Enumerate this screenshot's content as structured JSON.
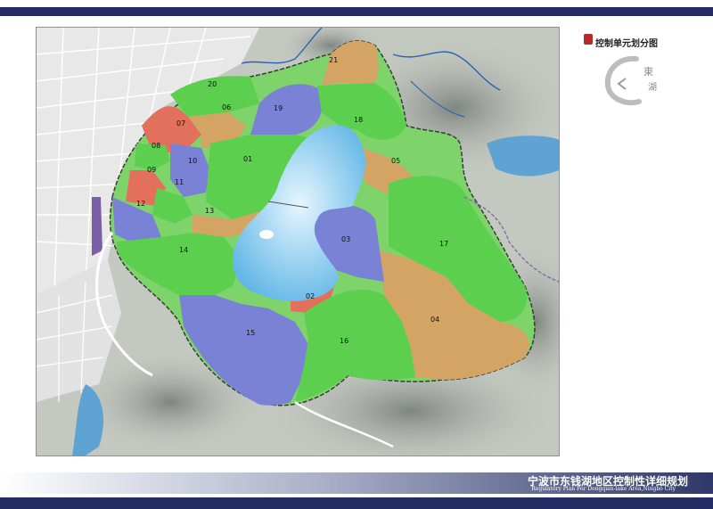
{
  "legend": {
    "title": "控制单元划分图"
  },
  "footer": {
    "title": "宁波市东钱湖地区控制性详细规划",
    "subtitle": "Regulatory Plan For Dongqian-lake Area,Ningbo City"
  },
  "colors": {
    "band": "#232d63",
    "green_zone": "#5ccf4f",
    "blue_zone": "#7a82d6",
    "orange_zone": "#d4a464",
    "red_zone": "#e2705c",
    "lake": "#8fd0f2",
    "terrain": "#b8beb6"
  },
  "icons": {
    "seal": "red-seal-icon",
    "logo": "dongqian-lake-logo-icon"
  },
  "units": [
    {
      "id": "01"
    },
    {
      "id": "02"
    },
    {
      "id": "03"
    },
    {
      "id": "04"
    },
    {
      "id": "05"
    },
    {
      "id": "06"
    },
    {
      "id": "07"
    },
    {
      "id": "08"
    },
    {
      "id": "09"
    },
    {
      "id": "10"
    },
    {
      "id": "11"
    },
    {
      "id": "12"
    },
    {
      "id": "13"
    },
    {
      "id": "14"
    },
    {
      "id": "15"
    },
    {
      "id": "16"
    },
    {
      "id": "17"
    },
    {
      "id": "18"
    },
    {
      "id": "19"
    },
    {
      "id": "20"
    },
    {
      "id": "21"
    }
  ]
}
